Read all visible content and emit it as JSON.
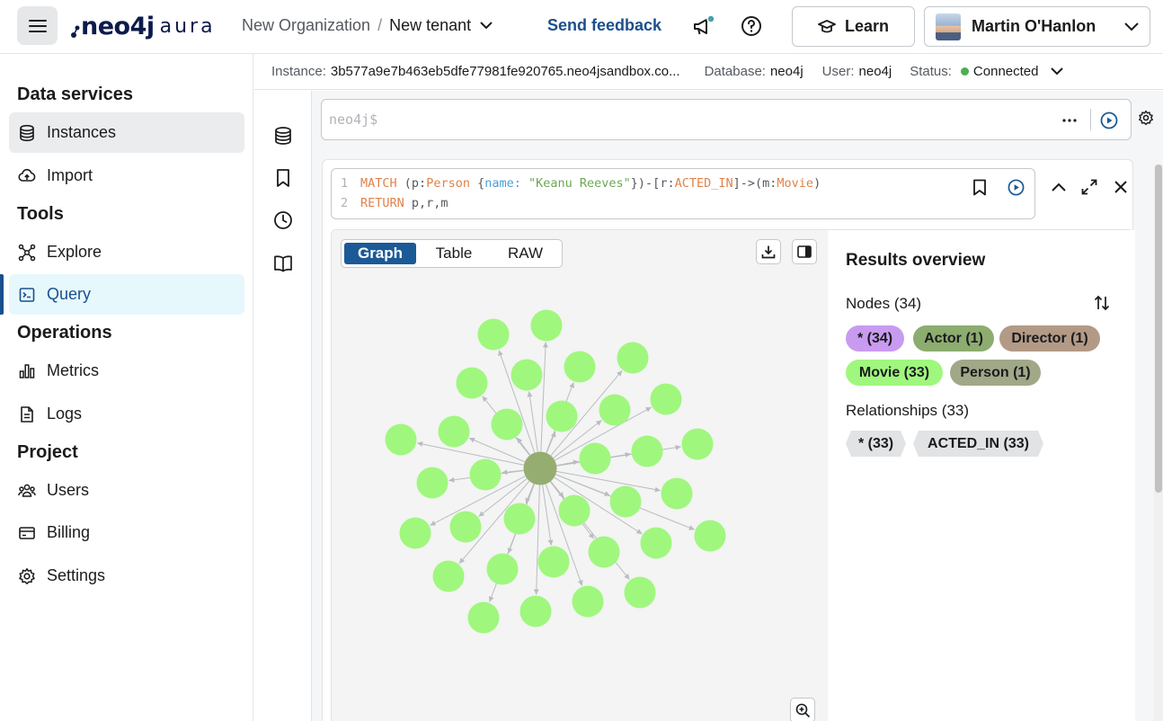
{
  "header": {
    "logo_text": "neo4j",
    "logo_suffix": "aura",
    "org": "New Organization",
    "separator": "/",
    "tenant": "New tenant",
    "feedback": "Send feedback",
    "learn": "Learn",
    "user_name": "Martin O'Hanlon"
  },
  "sidebar": {
    "sections": [
      {
        "title": "Data services"
      },
      {
        "title": "Tools"
      },
      {
        "title": "Operations"
      },
      {
        "title": "Project"
      }
    ],
    "items": [
      {
        "label": "Instances",
        "icon": "database-icon"
      },
      {
        "label": "Import",
        "icon": "cloud-upload-icon"
      },
      {
        "label": "Explore",
        "icon": "explore-icon"
      },
      {
        "label": "Query",
        "icon": "query-icon"
      },
      {
        "label": "Metrics",
        "icon": "metrics-icon"
      },
      {
        "label": "Logs",
        "icon": "logs-icon"
      },
      {
        "label": "Users",
        "icon": "users-icon"
      },
      {
        "label": "Billing",
        "icon": "billing-icon"
      },
      {
        "label": "Settings",
        "icon": "gear-icon"
      }
    ]
  },
  "instance_bar": {
    "instance_label": "Instance:",
    "instance_value": "3b577a9e7b463eb5dfe77981fe920765.neo4jsandbox.co...",
    "database_label": "Database:",
    "database_value": "neo4j",
    "user_label": "User:",
    "user_value": "neo4j",
    "status_label": "Status:",
    "status_value": "Connected",
    "status_color": "#4caf50"
  },
  "editor": {
    "placeholder": "neo4j$"
  },
  "query": {
    "line1_num": "1",
    "line2_num": "2",
    "match": "MATCH",
    "open1": " (",
    "var_p": "p",
    "colon1": ":",
    "label_person": "Person",
    "brace_open": " {",
    "prop_name": "name:",
    "str_val": " \"Keanu Reeves\"",
    "brace_close": "})-[",
    "var_r": "r",
    "colon2": ":",
    "rel_type": "ACTED_IN",
    "arrow": "]->(",
    "var_m": "m",
    "colon3": ":",
    "label_movie": "Movie",
    "close": ")",
    "return_kw": "RETURN",
    "return_vars": " p,r,m"
  },
  "result": {
    "tabs": [
      "Graph",
      "Table",
      "RAW"
    ],
    "active_tab": "Graph",
    "overview_title": "Results overview",
    "nodes_label": "Nodes (34)",
    "node_chips": [
      {
        "label": "* (34)",
        "color": "#c99bf0"
      },
      {
        "label": "Actor (1)",
        "color": "#8dac6f"
      },
      {
        "label": "Director (1)",
        "color": "#b39a86"
      },
      {
        "label": "Movie (33)",
        "color": "#a0f77e"
      },
      {
        "label": "Person (1)",
        "color": "#a0a888"
      }
    ],
    "relationships_label": "Relationships (33)",
    "rel_chips": [
      {
        "label": "* (33)"
      },
      {
        "label": "ACTED_IN (33)"
      }
    ]
  },
  "graph": {
    "center_node_color": "#96ad72",
    "movie_node_color": "#a0f77e",
    "edge_color": "#b9bcc0",
    "movie_node_count": 33
  },
  "colors": {
    "accent": "#1b4f8e",
    "active_tab": "#1b5a96",
    "active_nav_bg": "#e6f8fb",
    "feedback_dot": "#4a9dae"
  }
}
